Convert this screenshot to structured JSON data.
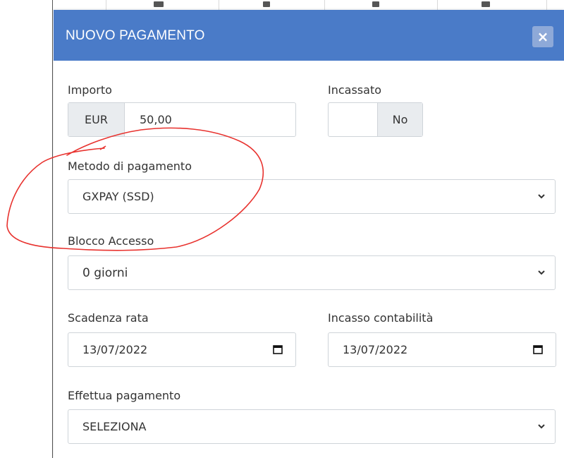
{
  "modal": {
    "title": "NUOVO PAGAMENTO",
    "close_label": "×"
  },
  "importo": {
    "label": "Importo",
    "currency": "EUR",
    "value": "50,00"
  },
  "incassato": {
    "label": "Incassato",
    "value": "No"
  },
  "metodo": {
    "label": "Metodo di pagamento",
    "selected": "GXPAY (SSD)"
  },
  "blocco": {
    "label": "Blocco Accesso",
    "selected": "0 giorni"
  },
  "scadenza": {
    "label": "Scadenza rata",
    "value": "13/07/2022"
  },
  "incasso": {
    "label": "Incasso contabilità",
    "value": "13/07/2022"
  },
  "effettua": {
    "label": "Effettua pagamento",
    "selected": "SELEZIONA"
  },
  "colors": {
    "header_bg": "#4a7bc8",
    "annotation": "#e8322e"
  },
  "icons": {
    "close": "close-icon",
    "select": "chevron-down-icon",
    "date": "calendar-icon"
  }
}
